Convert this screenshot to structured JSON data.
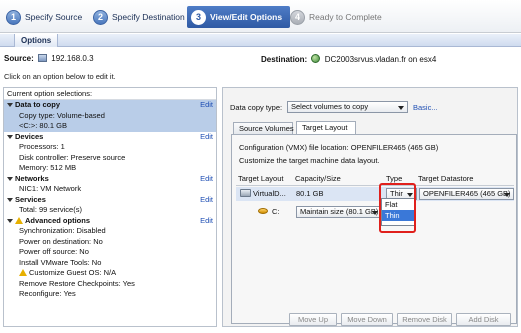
{
  "wizard": {
    "steps": [
      {
        "num": "1",
        "label": "Specify Source"
      },
      {
        "num": "2",
        "label": "Specify Destination"
      },
      {
        "num": "3",
        "label": "View/Edit Options"
      },
      {
        "num": "4",
        "label": "Ready to Complete"
      }
    ]
  },
  "options_tab": "Options",
  "source": {
    "label": "Source:",
    "value": "192.168.0.3"
  },
  "destination": {
    "label": "Destination:",
    "value": "DC2003srvus.vladan.fr on esx4"
  },
  "hint": "Click on an option below to edit it.",
  "left": {
    "header": "Current option selections:",
    "edit_label": "Edit",
    "sections": [
      {
        "title": "Data to copy",
        "items": [
          "Copy type: Volume-based",
          "<C:>: 80.1 GB"
        ]
      },
      {
        "title": "Devices",
        "items": [
          "Processors: 1",
          "Disk controller: Preserve source",
          "Memory: 512 MB"
        ]
      },
      {
        "title": "Networks",
        "items": [
          "NIC1: VM Network"
        ]
      },
      {
        "title": "Services",
        "items": [
          "Total: 99 service(s)"
        ]
      },
      {
        "title": "Advanced options",
        "items": [
          "Synchronization: Disabled",
          "Power on destination: No",
          "Power off source: No",
          "Install VMware Tools: No",
          "Customize Guest OS: N/A",
          "Remove Restore Checkpoints: Yes",
          "Reconfigure: Yes"
        ]
      }
    ]
  },
  "right": {
    "copy_type_label": "Data copy type:",
    "copy_type_value": "Select volumes to copy",
    "basic_link": "Basic...",
    "tabs": [
      "Source Volumes",
      "Target Layout"
    ],
    "config_label": "Configuration (VMX) file location:",
    "config_value": "OPENFILER465 (465 GB)",
    "customize_text": "Customize the target machine data layout.",
    "columns": [
      "Target Layout",
      "Capacity/Size",
      "Type",
      "Target Datastore"
    ],
    "vdisk": {
      "name": "VirtualD...",
      "size": "80.1 GB",
      "type": "Thir",
      "datastore": "OPENFILER465 (465 GB)"
    },
    "volume": {
      "name": "C:",
      "size_select": "Maintain size (80.1 GB)"
    },
    "type_options": [
      "Flat",
      "Thin"
    ],
    "buttons": [
      "Move Up",
      "Move Down",
      "Remove Disk",
      "Add Disk"
    ]
  }
}
